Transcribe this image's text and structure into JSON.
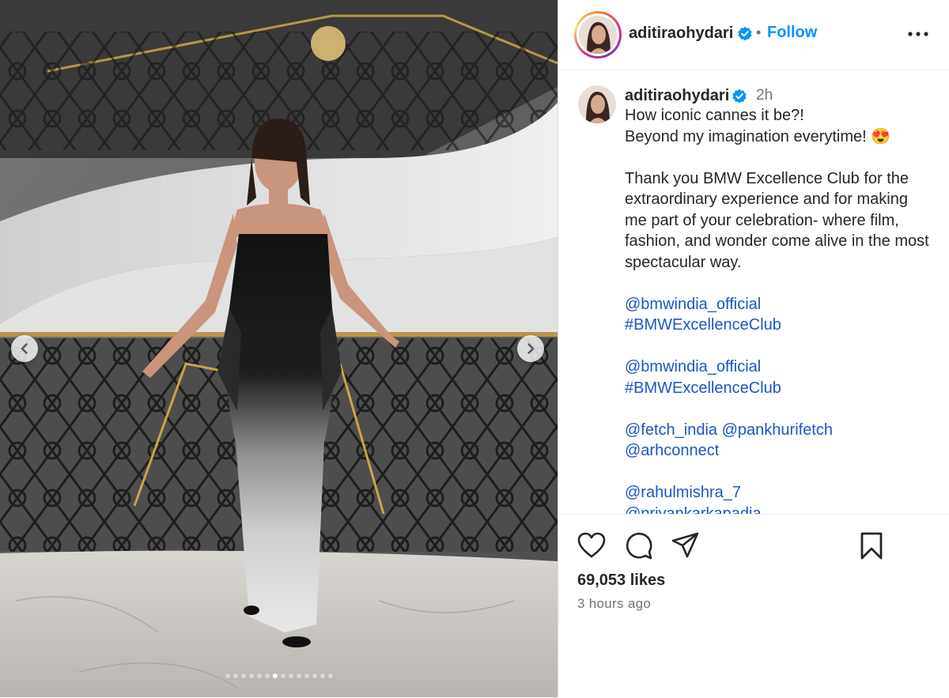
{
  "post": {
    "username": "aditiraohydari",
    "follow_label": "Follow",
    "separator": "•",
    "caption_time": "2h",
    "caption_lines": [
      "How iconic cannes it be?!",
      "Beyond my imagination everytime! 😍",
      "",
      "Thank you BMW Excellence Club for the extraordinary experience and for making me part of your celebration- where film, fashion, and wonder come alive in the most spectacular way.",
      ""
    ],
    "tags": [
      [
        "@bmwindia_official"
      ],
      [
        "#BMWExcellenceClub"
      ],
      [],
      [
        "@bmwindia_official"
      ],
      [
        "#BMWExcellenceClub"
      ],
      [],
      [
        "@fetch_india",
        "@pankhurifetch"
      ],
      [
        "@arhconnect"
      ],
      [],
      [
        "@rahulmishra_7"
      ],
      [
        "@priyankarkapadia"
      ]
    ],
    "likes": "69,053 likes",
    "posted": "3 hours ago"
  },
  "carousel": {
    "total": 14,
    "active_index": 6
  },
  "colors": {
    "accent": "#0095f6",
    "verified": "#0095f6",
    "link": "#1a57c5"
  },
  "icons": [
    "verified-badge-icon",
    "more-options-icon",
    "heart-icon",
    "comment-icon",
    "share-icon",
    "bookmark-icon",
    "chevron-left-icon",
    "chevron-right-icon"
  ]
}
